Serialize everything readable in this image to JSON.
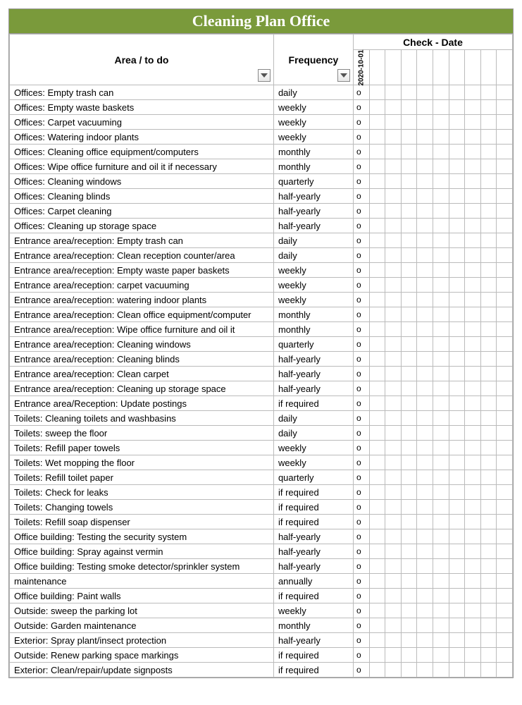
{
  "title": "Cleaning Plan Office",
  "headers": {
    "area": "Area / to do",
    "frequency": "Frequency",
    "check_date": "Check - Date"
  },
  "date_columns": [
    "2020-10-01",
    "",
    "",
    "",
    "",
    "",
    "",
    "",
    "",
    ""
  ],
  "mark": "o",
  "rows": [
    {
      "area": "Offices: Empty trash can",
      "freq": "daily"
    },
    {
      "area": "Offices: Empty waste baskets",
      "freq": "weekly"
    },
    {
      "area": "Offices: Carpet vacuuming",
      "freq": "weekly"
    },
    {
      "area": "Offices: Watering indoor plants",
      "freq": "weekly"
    },
    {
      "area": "Offices: Cleaning office equipment/computers",
      "freq": "monthly"
    },
    {
      "area": "Offices: Wipe office furniture and oil it if necessary",
      "freq": "monthly"
    },
    {
      "area": "Offices: Cleaning windows",
      "freq": "quarterly"
    },
    {
      "area": "Offices: Cleaning blinds",
      "freq": "half-yearly"
    },
    {
      "area": "Offices: Carpet cleaning",
      "freq": "half-yearly"
    },
    {
      "area": "Offices: Cleaning up storage space",
      "freq": "half-yearly"
    },
    {
      "area": "Entrance area/reception: Empty trash can",
      "freq": "daily"
    },
    {
      "area": "Entrance area/reception: Clean reception counter/area",
      "freq": "daily"
    },
    {
      "area": "Entrance area/reception: Empty waste paper baskets",
      "freq": "weekly"
    },
    {
      "area": "Entrance area/reception: carpet vacuuming",
      "freq": "weekly"
    },
    {
      "area": "Entrance area/reception: watering indoor plants",
      "freq": "weekly"
    },
    {
      "area": "Entrance area/reception: Clean office equipment/computer",
      "freq": "monthly"
    },
    {
      "area": "Entrance area/reception: Wipe office furniture and oil it",
      "freq": "monthly"
    },
    {
      "area": "Entrance area/reception: Cleaning windows",
      "freq": "quarterly"
    },
    {
      "area": "Entrance area/reception: Cleaning blinds",
      "freq": "half-yearly"
    },
    {
      "area": "Entrance area/reception: Clean carpet",
      "freq": "half-yearly"
    },
    {
      "area": "Entrance area/reception: Cleaning up storage space",
      "freq": "half-yearly"
    },
    {
      "area": "Entrance area/Reception: Update postings",
      "freq": "if required"
    },
    {
      "area": "Toilets: Cleaning toilets and washbasins",
      "freq": "daily"
    },
    {
      "area": "Toilets: sweep the floor",
      "freq": "daily"
    },
    {
      "area": "Toilets: Refill paper towels",
      "freq": "weekly"
    },
    {
      "area": "Toilets: Wet mopping the floor",
      "freq": "weekly"
    },
    {
      "area": "Toilets: Refill toilet paper",
      "freq": "quarterly"
    },
    {
      "area": "Toilets: Check for leaks",
      "freq": "if required"
    },
    {
      "area": "Toilets: Changing towels",
      "freq": "if required"
    },
    {
      "area": "Toilets: Refill soap dispenser",
      "freq": "if required"
    },
    {
      "area": "Office building: Testing the security system",
      "freq": "half-yearly"
    },
    {
      "area": "Office building: Spray against vermin",
      "freq": "half-yearly"
    },
    {
      "area": "Office building: Testing smoke detector/sprinkler system",
      "freq": "half-yearly"
    },
    {
      "area": "maintenance",
      "freq": "annually"
    },
    {
      "area": "Office building: Paint walls",
      "freq": "if required"
    },
    {
      "area": "Outside: sweep the parking lot",
      "freq": "weekly"
    },
    {
      "area": "Outside: Garden maintenance",
      "freq": "monthly"
    },
    {
      "area": "Exterior: Spray plant/insect protection",
      "freq": "half-yearly"
    },
    {
      "area": "Outside: Renew parking space markings",
      "freq": "if required"
    },
    {
      "area": "Exterior: Clean/repair/update signposts",
      "freq": "if required"
    }
  ]
}
